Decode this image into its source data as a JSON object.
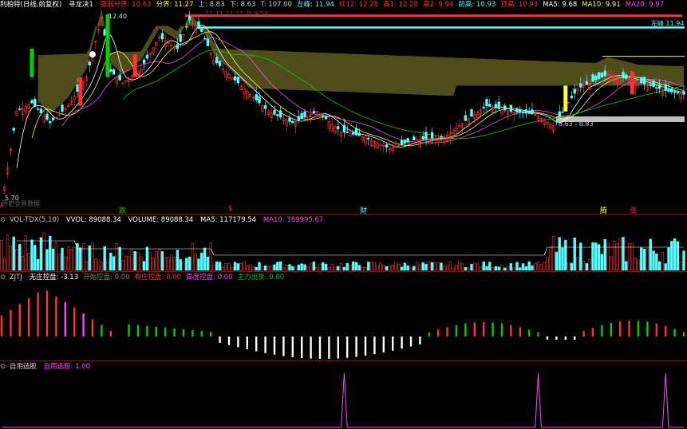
{
  "colors": {
    "red": "#ff3333",
    "cyan": "#54ffff",
    "green": "#00d000",
    "magenta": "#ff44ff",
    "white": "#ffffff",
    "yellow": "#ffff33",
    "olive": "#5c5a1e",
    "grey": "#bfbfbf"
  },
  "main_header": {
    "title": "利柏特(日线,前复权)",
    "indicator": "寻龙决1",
    "items": [
      {
        "label": "强弱分界:",
        "value": "10.63",
        "color": "#ff3333"
      },
      {
        "label": "分界:",
        "value": "11.27",
        "color": "#ffff33"
      },
      {
        "label": "上:",
        "value": "8.83",
        "color": "#cccccc"
      },
      {
        "label": "下:",
        "value": "8.63",
        "color": "#cccccc"
      },
      {
        "label": "T:",
        "value": "107.00",
        "color": "#cccccc"
      },
      {
        "label": "左峰:",
        "value": "11.94",
        "color": "#54ffff"
      },
      {
        "label": "红12:",
        "value": "12.28",
        "color": "#ff3333"
      },
      {
        "label": "高1:",
        "value": "12.28",
        "color": "#ff3333"
      },
      {
        "label": "高2:",
        "value": "9.94",
        "color": "#ff3333"
      },
      {
        "label": "前高:",
        "value": "10.93",
        "color": "#54ffff"
      },
      {
        "label": "顶高:",
        "value": "10.93",
        "color": "#ff3333"
      },
      {
        "label": "MA5:",
        "value": "9.68",
        "color": "#ffffff"
      },
      {
        "label": "MA10:",
        "value": "9.91",
        "color": "#ffff33"
      },
      {
        "label": "MA20:",
        "value": "9.97",
        "color": "#ff44ff"
      }
    ]
  },
  "annotations": {
    "high_price": "12.40",
    "low_price": "5.70",
    "left_peak": "左峰 11.94",
    "range": "8.63 - 8.83",
    "faded_line": "11.11 11.11 及  9.59",
    "overlay_text": "历史全景数据",
    "tag_die": "跌",
    "tag_s": "$",
    "tag_cai": "财",
    "tag_teng": "腾",
    "tag_zhang": "涨"
  },
  "vol_header": {
    "name": "VOL-TDX(5,10)",
    "vvol": "VVOL: 89088.34",
    "volume": "VOLUME: 89088.34",
    "ma5": "MA5: 117179.54",
    "ma10": "MA10: 189995.67"
  },
  "zjtj_header": {
    "name": "ZJTJ",
    "items": [
      {
        "text": "无庄控盘: -3.13",
        "color": "#ffffff"
      },
      {
        "text": "开始控盘: 0.00",
        "color": "#808080"
      },
      {
        "text": "有庄控盘: 0.00",
        "color": "#ff3333"
      },
      {
        "text": "高度控盘: 0.00",
        "color": "#ff44ff"
      },
      {
        "text": "主力出货: 0.00",
        "color": "#00d000"
      }
    ]
  },
  "select_header": {
    "name": "自用选股",
    "item": "自用选股: 1.00"
  },
  "chart_data": [
    {
      "type": "candlestick",
      "name": "利柏特(日线,前复权)",
      "ylim": [
        5.7,
        12.4
      ],
      "series": [
        {
          "name": "MA5"
        },
        {
          "name": "MA10"
        },
        {
          "name": "MA20"
        }
      ]
    },
    {
      "type": "bar",
      "name": "VOL-TDX(5,10)"
    },
    {
      "type": "bar",
      "name": "ZJTJ"
    },
    {
      "type": "line",
      "name": "自用选股",
      "spikes_at_index": [
        113,
        177,
        219
      ],
      "value": 1.0
    }
  ]
}
